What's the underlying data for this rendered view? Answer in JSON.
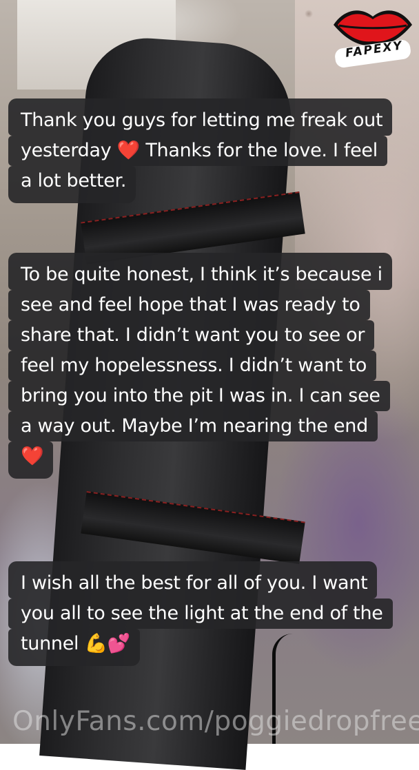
{
  "messages": [
    {
      "lines": [
        "Thank you guys for letting me freak out",
        "yesterday ❤️ Thanks for the love. I feel",
        "a lot better."
      ]
    },
    {
      "lines": [
        "To be quite honest, I think it’s because i",
        "see and feel hope that I was ready to",
        "share that. I didn’t want you to see or",
        "feel my hopelessness. I didn’t want to",
        "bring you into the pit I was in. I can see",
        "a way out. Maybe I’m nearing the end",
        "❤️"
      ]
    },
    {
      "lines": [
        "I wish all the best for all of you. I want",
        "you all to see the light at the end of the",
        "tunnel 💪💕"
      ]
    }
  ],
  "logo": {
    "text": "FAPEXY",
    "color": "#e0151b"
  },
  "watermark": "OnlyFans.com/poggiedropfree",
  "colors": {
    "bubble": "#262628",
    "text": "#ffffff"
  }
}
